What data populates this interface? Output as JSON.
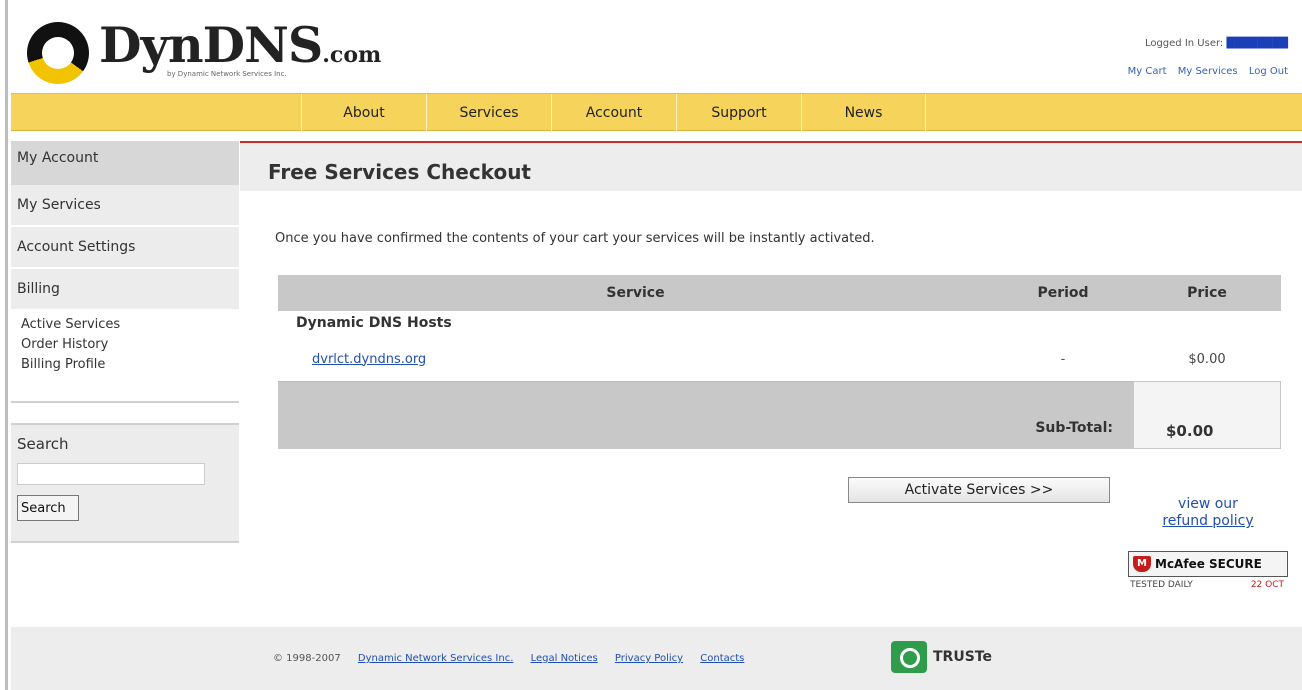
{
  "header": {
    "logo_text": "DynDNS",
    "logo_suffix": ".com",
    "logo_sub": "by Dynamic Network Services Inc.",
    "logged_in_label": "Logged In User:",
    "user_links": [
      "My Cart",
      "My Services",
      "Log Out"
    ]
  },
  "nav": {
    "items": [
      "About",
      "Services",
      "Account",
      "Support",
      "News"
    ]
  },
  "sidebar": {
    "title": "My Account",
    "items": [
      "My Services",
      "Account Settings",
      "Billing"
    ],
    "billing_sub": [
      "Active Services",
      "Order History",
      "Billing Profile"
    ],
    "search_title": "Search",
    "search_button": "Search"
  },
  "main": {
    "title": "Free Services Checkout",
    "intro": "Once you have confirmed the contents of your cart your services will be instantly activated.",
    "table": {
      "headers": [
        "Service",
        "Period",
        "Price"
      ],
      "group": "Dynamic DNS Hosts",
      "rows": [
        {
          "service": "dvrlct.dyndns.org",
          "period": "-",
          "price": "$0.00"
        }
      ],
      "subtotal_label": "Sub-Total:",
      "subtotal_value": "$0.00"
    },
    "activate_button": "Activate Services >>",
    "refund_line1": "view our",
    "refund_line2": "refund policy",
    "mcafee_label": "McAfee SECURE",
    "mcafee_tested": "TESTED DAILY",
    "mcafee_date": "22 OCT"
  },
  "footer": {
    "copyright": "© 1998-2007",
    "links": [
      "Dynamic Network Services Inc.",
      "Legal Notices",
      "Privacy Policy",
      "Contacts"
    ],
    "truste": "TRUSTe"
  },
  "colors": {
    "nav_bg": "#f6d45c",
    "title_rule": "#d12a2a",
    "link": "#1f4fb3"
  }
}
